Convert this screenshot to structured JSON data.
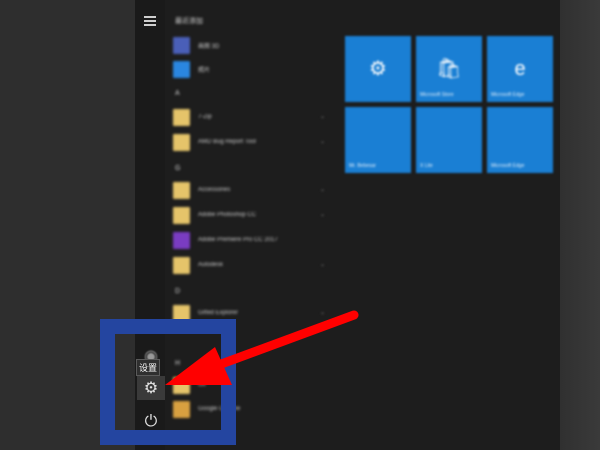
{
  "start_menu": {
    "sections": [
      {
        "id": "recent",
        "header": "最近添加"
      },
      {
        "id": "a",
        "header": "A"
      },
      {
        "id": "g",
        "header": "G"
      },
      {
        "id": "d",
        "header": "D"
      },
      {
        "id": "h",
        "header": "H"
      }
    ],
    "apps": [
      {
        "label": "画图 3D",
        "icon_color": "#4a5fb8"
      },
      {
        "label": "照片",
        "icon_color": "#2a86e0"
      },
      {
        "label": "7-Zip",
        "icon_color": "#e5c46a"
      },
      {
        "label": "AMD Bug Report Tool",
        "icon_color": "#e5c46a"
      },
      {
        "label": "Accessories",
        "icon_color": "#e5c46a"
      },
      {
        "label": "Adobe Photoshop CC",
        "icon_color": "#e5c46a"
      },
      {
        "label": "Adobe Premiere Pro CC 2017",
        "icon_color": "#7a3cc2"
      },
      {
        "label": "Autodesk",
        "icon_color": "#e5c46a"
      },
      {
        "label": "Gifted Explorer",
        "icon_color": "#e5c46a"
      },
      {
        "label": "Git",
        "icon_color": "#e5c46a"
      },
      {
        "label": "Google Chrome",
        "icon_color": "#d8a040"
      }
    ],
    "tiles": [
      {
        "label": "",
        "icon": "gear-icon",
        "glyph": "⚙"
      },
      {
        "label": "Microsoft Store",
        "icon": "store-icon",
        "glyph": "🛍"
      },
      {
        "label": "Microsoft Edge",
        "icon": "edge-icon",
        "glyph": "e"
      },
      {
        "label": "Mr. Bebesar",
        "icon": "",
        "glyph": ""
      },
      {
        "label": "X Lite",
        "icon": "",
        "glyph": ""
      },
      {
        "label": "Microsoft Edge",
        "icon": "",
        "glyph": ""
      }
    ],
    "rail": {
      "settings_tooltip": "设置",
      "user_glyph": "◉",
      "settings_glyph": "⚙",
      "power_glyph": "⏻"
    }
  },
  "colors": {
    "tile_blue": "#1a7fd4",
    "highlight_blue": "#2445a0",
    "arrow_red": "#ff0000"
  }
}
